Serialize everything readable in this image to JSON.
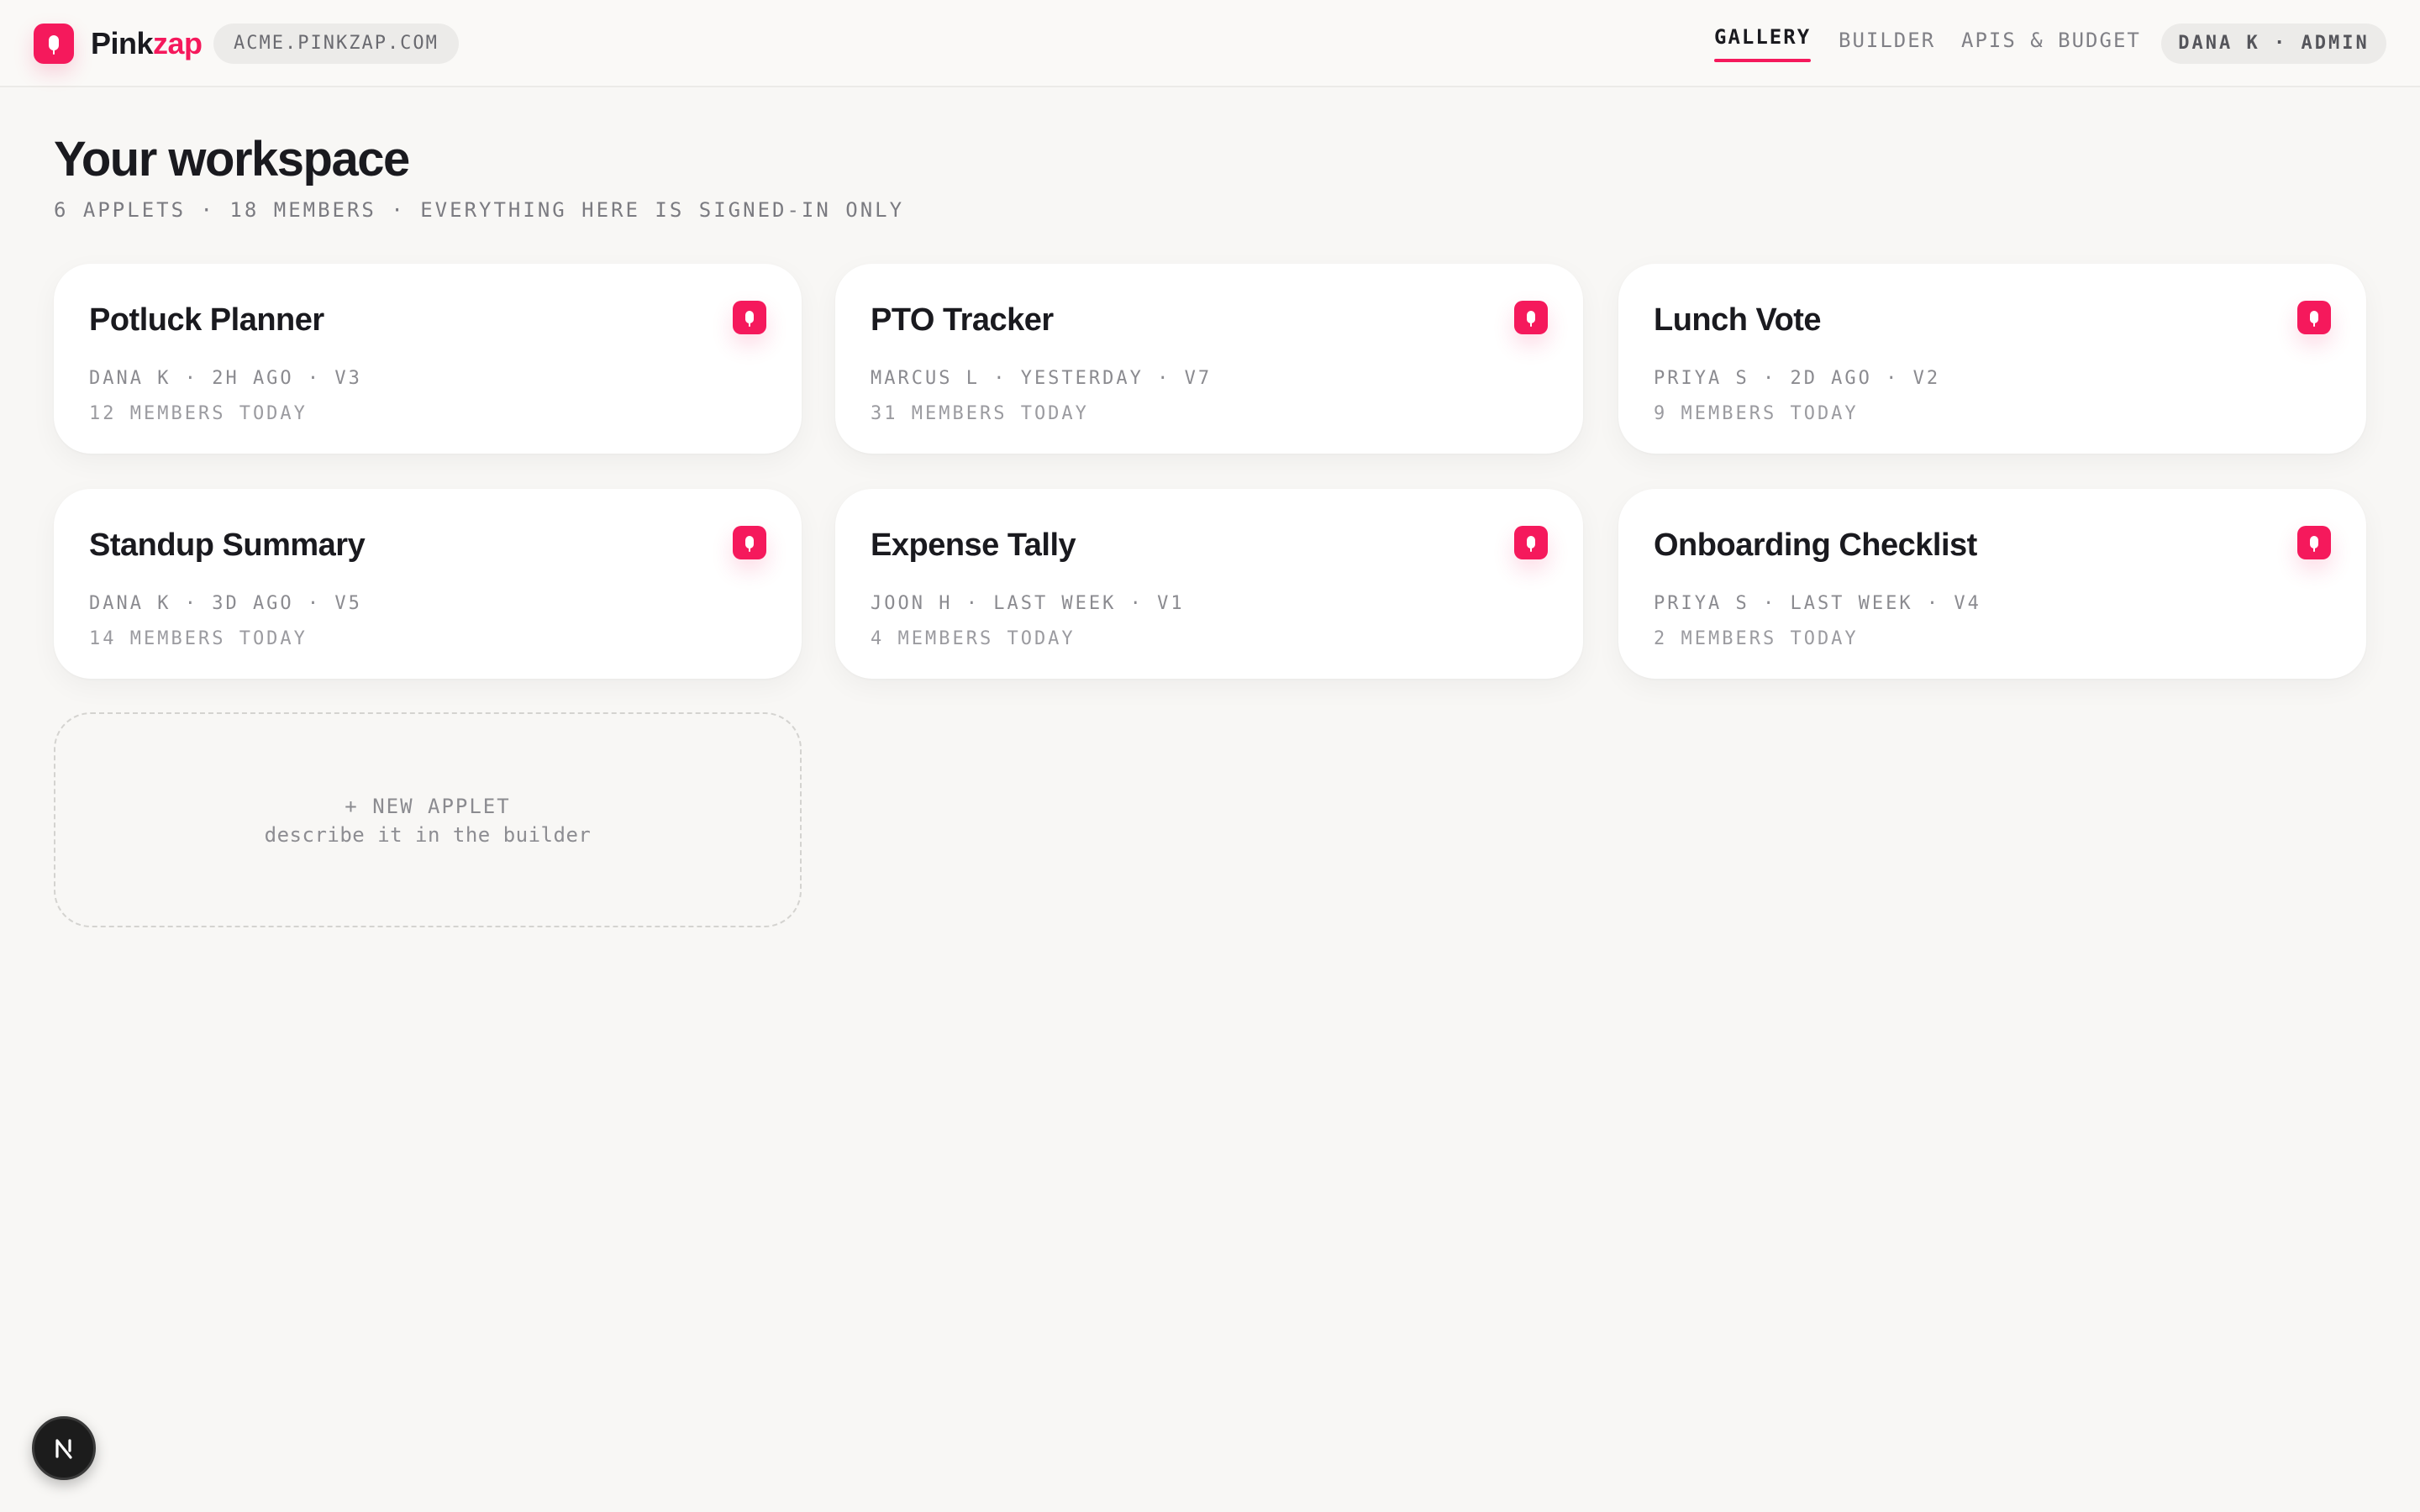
{
  "header": {
    "brand": {
      "part1": "Pink",
      "part2": "zap"
    },
    "domain": "ACME.PINKZAP.COM",
    "nav": [
      {
        "label": "GALLERY",
        "active": true
      },
      {
        "label": "BUILDER",
        "active": false
      },
      {
        "label": "APIS & BUDGET",
        "active": false
      }
    ],
    "user": "DANA K · ADMIN"
  },
  "page": {
    "title": "Your workspace",
    "subtitle": "6 APPLETS · 18 MEMBERS · EVERYTHING HERE IS SIGNED-IN ONLY"
  },
  "applets": [
    {
      "title": "Potluck Planner",
      "meta": "DANA K · 2H AGO · V3",
      "members": "12 MEMBERS TODAY"
    },
    {
      "title": "PTO Tracker",
      "meta": "MARCUS L · YESTERDAY · V7",
      "members": "31 MEMBERS TODAY"
    },
    {
      "title": "Lunch Vote",
      "meta": "PRIYA S · 2D AGO · V2",
      "members": "9 MEMBERS TODAY"
    },
    {
      "title": "Standup Summary",
      "meta": "DANA K · 3D AGO · V5",
      "members": "14 MEMBERS TODAY"
    },
    {
      "title": "Expense Tally",
      "meta": "JOON H · LAST WEEK · V1",
      "members": "4 MEMBERS TODAY"
    },
    {
      "title": "Onboarding Checklist",
      "meta": "PRIYA S · LAST WEEK · V4",
      "members": "2 MEMBERS TODAY"
    }
  ],
  "new_applet": {
    "label": "+ NEW APPLET",
    "hint": "describe it in the builder"
  },
  "colors": {
    "accent": "#f5195c",
    "background": "#f8f7f5"
  },
  "icons": {
    "brand": "pinkzap-logo-icon",
    "applet": "applet-icon",
    "badge": "next-logo-icon"
  }
}
